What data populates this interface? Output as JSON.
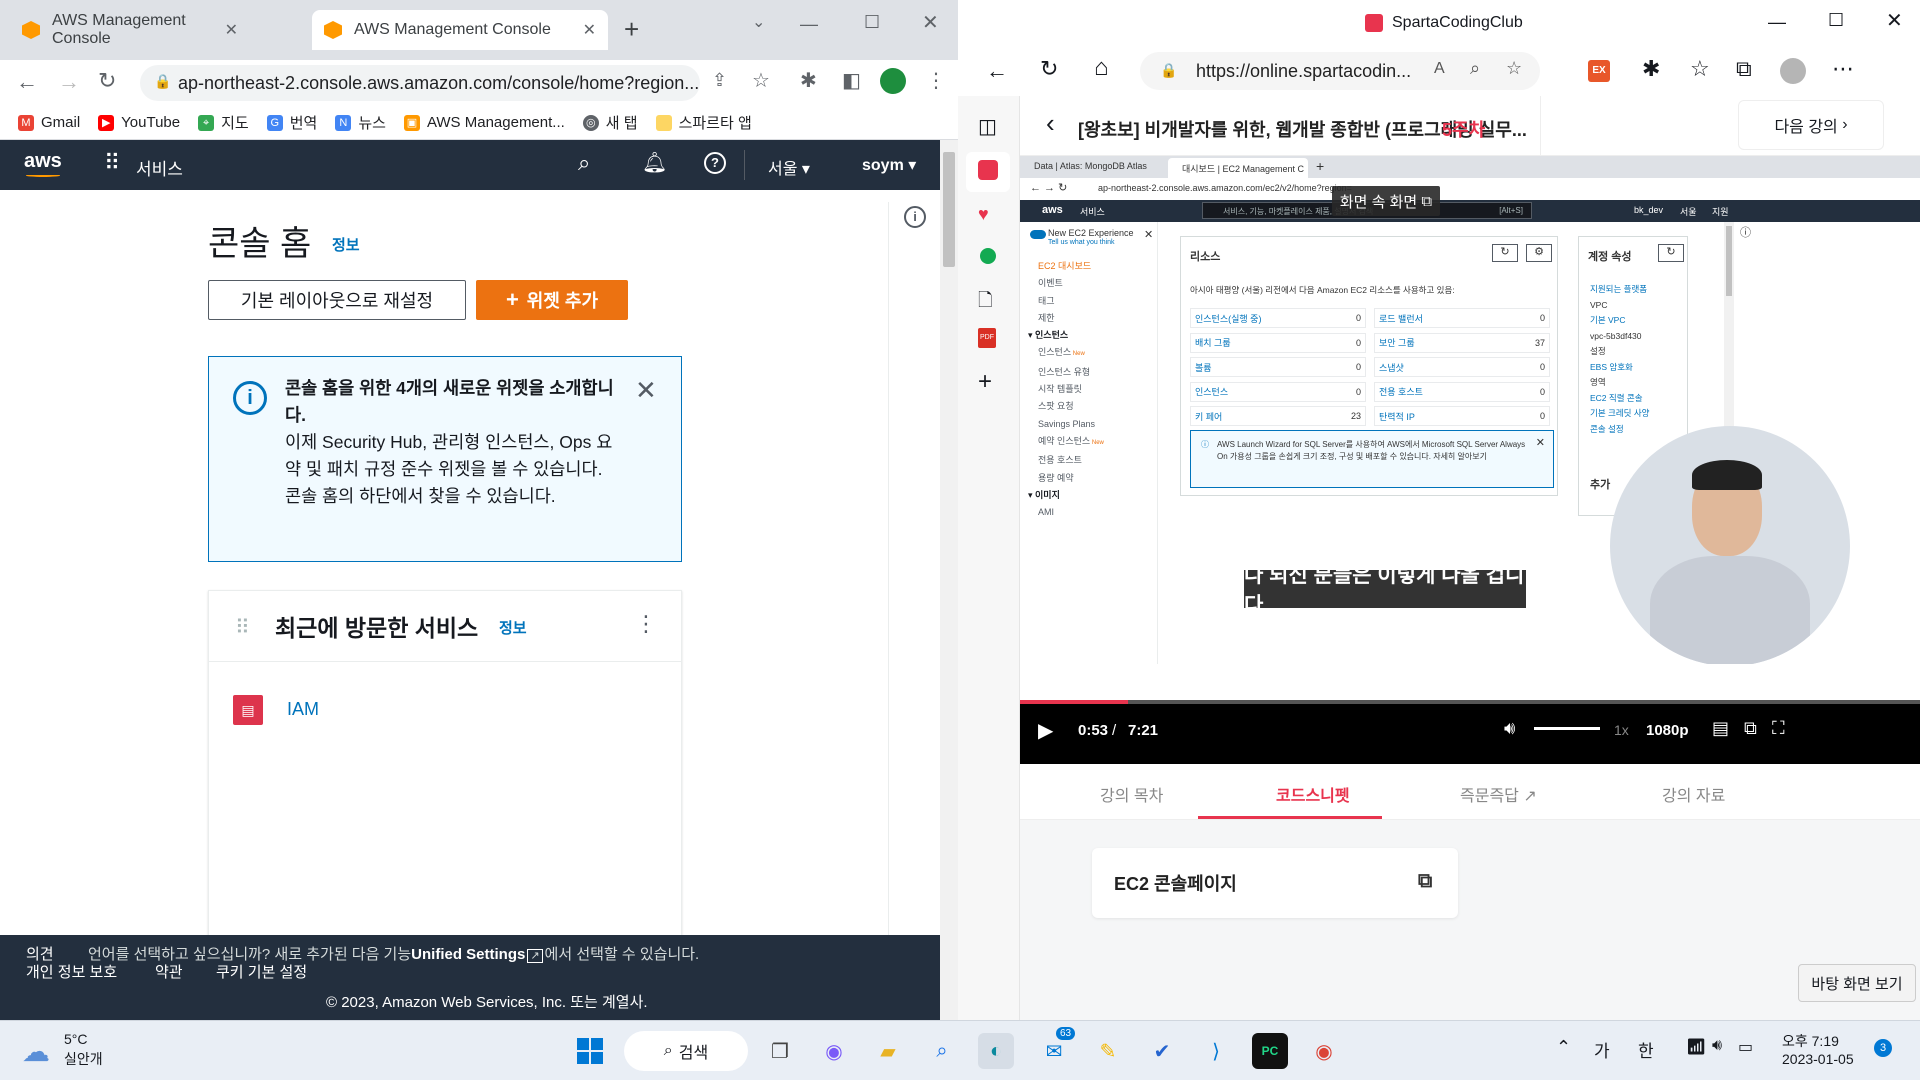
{
  "left_browser": {
    "tabs": [
      {
        "title": "AWS Management Console"
      },
      {
        "title": "AWS Management Console"
      }
    ],
    "url": "ap-northeast-2.console.aws.amazon.com/console/home?region...",
    "bookmarks": [
      "Gmail",
      "YouTube",
      "지도",
      "번역",
      "뉴스",
      "AWS Management...",
      "새 탭",
      "스파르타 앱"
    ],
    "aws_nav": {
      "logo": "aws",
      "services": "서비스",
      "region": "서울",
      "user": "soym"
    },
    "page_title": "콘솔 홈",
    "info_link": "정보",
    "reset_button": "기본 레이아웃으로 재설정",
    "add_widget_button": "위젯 추가",
    "alert": {
      "title": "콘솔 홈을 위한 4개의 새로운 위젯을 소개합니다.",
      "body": "이제 Security Hub, 관리형 인스턴스, Ops 요약 및 패치 규정 준수 위젯을 볼 수 있습니다. 콘솔 홈의 하단에서 찾을 수 있습니다."
    },
    "recent": {
      "title": "최근에 방문한 서비스",
      "info": "정보",
      "items": [
        "IAM"
      ]
    },
    "footer": {
      "feedback": "의견",
      "language_pre": "언어를 선택하고 싶으십니까? 새로 추가된 다음 기능",
      "unified": "Unified Settings",
      "language_post": "에서 선택할 수 있습니다.",
      "privacy": "개인 정보 보호",
      "terms": "약관",
      "cookies": "쿠키 기본 설정",
      "copyright": "© 2023, Amazon Web Services, Inc. 또는 계열사."
    }
  },
  "right_browser": {
    "window_title": "SpartaCodingClub",
    "url": "https://online.spartacodin...",
    "course_title": "[왕초보] 비개발자를 위한, 웹개발 종합반 (프로그래밍 실무...",
    "week": "5주차",
    "next_button": "다음 강의",
    "pip_label": "화면 속 화면",
    "subtitle": "다 되신 분들은 이렇게 나올 겁니다",
    "time_current": "0:53",
    "time_sep": "/",
    "time_total": "7:21",
    "speed": "1x",
    "quality": "1080p",
    "progress": 0.12,
    "tabs": [
      "강의 목차",
      "코드스니펫",
      "즉문즉답",
      "강의 자료"
    ],
    "snippet": "EC2 콘솔페이지",
    "desktop_tooltip": "바탕 화면 보기",
    "inner": {
      "tabs": [
        "Data | Atlas: MongoDB Atlas",
        "대시보드 | EC2 Management C"
      ],
      "url": "ap-northeast-2.console.aws.amazon.com/ec2/v2/home?region=",
      "services": "서비스",
      "search": "서비스, 기능, 마켓플레이스 제품, 설명서 검색",
      "shortcut": "[Alt+S]",
      "user": "bk_dev",
      "region": "서울",
      "support": "지원",
      "new_exp": "New EC2 Experience",
      "new_exp_sub": "Tell us what you think",
      "nav": [
        "EC2 대시보드",
        "이벤트",
        "태그",
        "제한",
        "인스턴스",
        "인스턴스",
        "인스턴스 유형",
        "시작 템플릿",
        "스팟 요청",
        "Savings Plans",
        "예약 인스턴스",
        "전용 호스트",
        "용량 예약",
        "이미지",
        "AMI"
      ],
      "new_badge": "New",
      "resources_title": "리소스",
      "resources_desc": "아시아 태평양 (서울) 리전에서 다음 Amazon EC2 리소스를 사용하고 있음:",
      "resources": [
        [
          "인스턴스(실행 중)",
          "0"
        ],
        [
          "로드 밸런서",
          "0"
        ],
        [
          "배치 그룹",
          "0"
        ],
        [
          "보안 그룹",
          "37"
        ],
        [
          "볼륨",
          "0"
        ],
        [
          "스냅샷",
          "0"
        ],
        [
          "인스턴스",
          "0"
        ],
        [
          "전용 호스트",
          "0"
        ],
        [
          "키 페어",
          "23"
        ],
        [
          "탄력적 IP",
          "0"
        ]
      ],
      "notice": "AWS Launch Wizard for SQL Server를 사용하여 AWS에서 Microsoft SQL Server Always On 가용성 그룹을 손쉽게 크기 조정, 구성 및 배포할 수 있습니다. 자세히 알아보기",
      "account_title": "계정 속성",
      "account": [
        "지원되는 플랫폼",
        "VPC",
        "기본 VPC",
        "vpc-5b3df430",
        "설정",
        "EBS 암호화",
        "영역",
        "EC2 직렬 콘솔",
        "기본 크레딧 사양",
        "콘솔 설정"
      ],
      "extra": "추가"
    }
  },
  "taskbar": {
    "weather_temp": "5°C",
    "weather_desc": "실안개",
    "search": "검색",
    "badge": "63",
    "ime1": "가",
    "ime2": "한",
    "time": "오후 7:19",
    "date": "2023-01-05",
    "notif": "3"
  }
}
